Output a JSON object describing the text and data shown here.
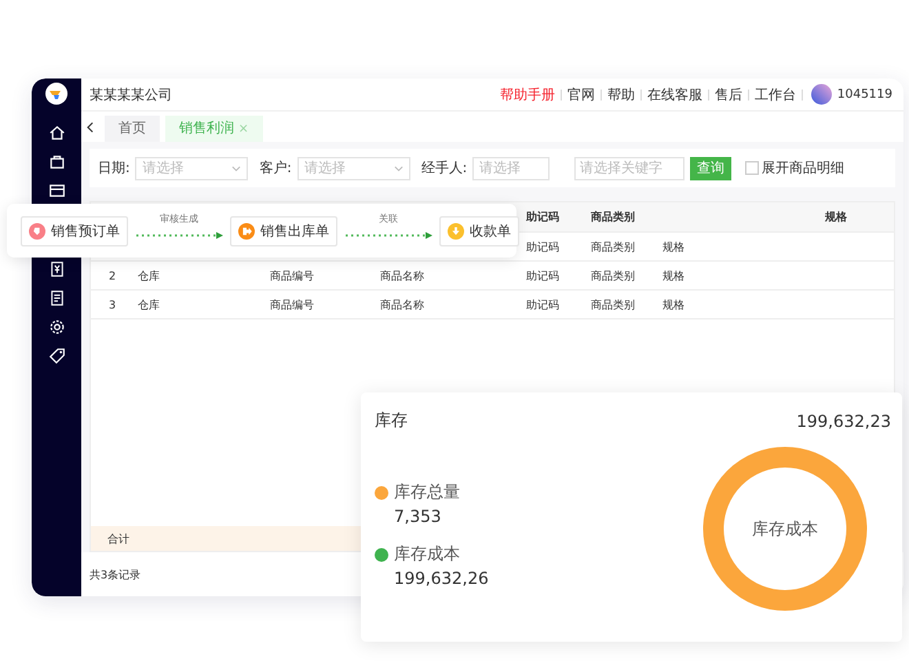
{
  "company": "某某某某公司",
  "top_links": [
    {
      "label": "帮助手册",
      "highlight": true
    },
    {
      "label": "官网",
      "highlight": false
    },
    {
      "label": "帮助",
      "highlight": false
    },
    {
      "label": "在线客服",
      "highlight": false
    },
    {
      "label": "售后",
      "highlight": false
    },
    {
      "label": "工作台",
      "highlight": false
    }
  ],
  "user": {
    "id": "1045119"
  },
  "tabs": [
    {
      "label": "首页",
      "selected": false
    },
    {
      "label": "销售利润",
      "selected": true,
      "close": "×"
    }
  ],
  "filters": {
    "date": {
      "label": "日期:",
      "placeholder": "请选择"
    },
    "customer": {
      "label": "客户:",
      "placeholder": "请选择"
    },
    "handler": {
      "label": "经手人:",
      "placeholder": "请选择"
    },
    "keyword": {
      "placeholder": "请选择关键字"
    },
    "search_button": "查询",
    "expand": {
      "label": "展开商品明细",
      "checked": false
    }
  },
  "table": {
    "header": {
      "mnemonic": "助记码",
      "category": "商品类别",
      "spec": "规格"
    },
    "rows": [
      {
        "mnemonic": "助记码",
        "category": "商品类别",
        "spec": "规格"
      },
      {
        "index": "2",
        "warehouse": "仓库",
        "item_code": "商品编号",
        "item_name": "商品名称",
        "mnemonic": "助记码",
        "category": "商品类别",
        "spec": "规格"
      },
      {
        "index": "3",
        "warehouse": "仓库",
        "item_code": "商品编号",
        "item_name": "商品名称",
        "mnemonic": "助记码",
        "category": "商品类别",
        "spec": "规格"
      }
    ],
    "total_label": "合计"
  },
  "footer": "共3条记录",
  "flow": {
    "steps": [
      {
        "label": "销售预订单",
        "color": "#f97f87"
      },
      {
        "label": "销售出库单",
        "color": "#fa8c16"
      },
      {
        "label": "收款单",
        "color": "#fbc02d"
      }
    ],
    "links": [
      "审核生成",
      "关联"
    ]
  },
  "stock": {
    "title": "库存",
    "value": "199,632,23",
    "legend": [
      {
        "label": "库存总量",
        "value": "7,353",
        "color": "#fba63c"
      },
      {
        "label": "库存成本",
        "value": "199,632,26",
        "color": "#3fb34f"
      }
    ],
    "donut_label": "库存成本"
  }
}
